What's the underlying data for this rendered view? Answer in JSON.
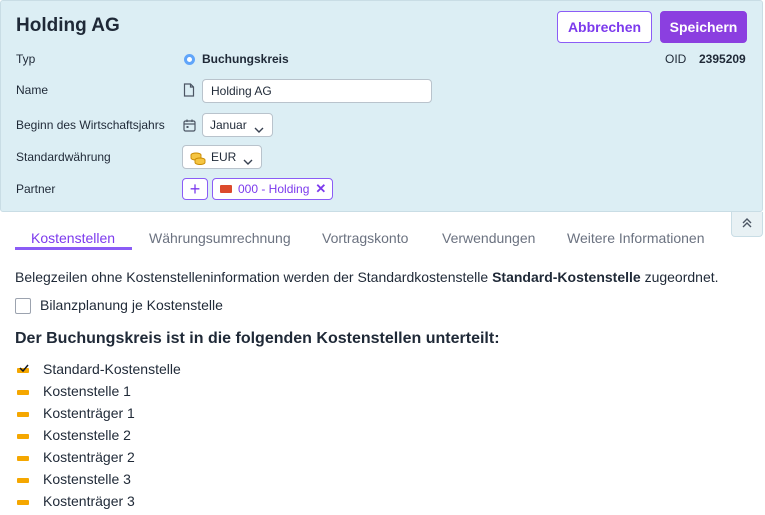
{
  "header": {
    "title": "Holding AG",
    "cancel_label": "Abbrechen",
    "save_label": "Speichern",
    "oid_label": "OID",
    "oid_value": "2395209"
  },
  "form": {
    "type_label": "Typ",
    "type_value": "Buchungskreis",
    "name_label": "Name",
    "name_value": "Holding AG",
    "fiscal_label": "Beginn des Wirtschaftsjahrs",
    "fiscal_value": "Januar",
    "currency_label": "Standardwährung",
    "currency_value": "EUR",
    "partner_label": "Partner",
    "partner_add": "+",
    "partner_chip": "000 - Holding",
    "partner_remove": "✕"
  },
  "tabs": [
    {
      "label": "Kostenstellen",
      "active": true
    },
    {
      "label": "Währungsumrechnung",
      "active": false
    },
    {
      "label": "Vortragskonto",
      "active": false
    },
    {
      "label": "Verwendungen",
      "active": false
    },
    {
      "label": "Weitere Informationen",
      "active": false
    }
  ],
  "content": {
    "info_prefix": "Belegzeilen ohne Kostenstelleninformation werden der Standardkostenstelle ",
    "info_bold": "Standard-Kostenstelle",
    "info_suffix": " zugeordnet.",
    "checkbox_label": "Bilanzplanung je Kostenstelle",
    "checkbox_checked": false,
    "section_heading": "Der Buchungskreis ist in die folgenden Kostenstellen unterteilt:",
    "cost_centers": [
      {
        "label": "Standard-Kostenstelle",
        "default": true
      },
      {
        "label": "Kostenstelle 1",
        "default": false
      },
      {
        "label": "Kostenträger 1",
        "default": false
      },
      {
        "label": "Kostenstelle 2",
        "default": false
      },
      {
        "label": "Kostenträger 2",
        "default": false
      },
      {
        "label": "Kostenstelle 3",
        "default": false
      },
      {
        "label": "Kostenträger 3",
        "default": false
      }
    ]
  },
  "colors": {
    "accent": "#8b3fe0",
    "header_bg": "#dceef4",
    "cost_center_marker": "#f5a700",
    "radio": "#60a5fa",
    "flag": "#dc4a2c"
  },
  "icons": {
    "type": "radio-icon",
    "name": "document-icon",
    "fiscal": "calendar-icon",
    "currency": "coins-icon",
    "collapse": "double-chevron-up-icon"
  }
}
